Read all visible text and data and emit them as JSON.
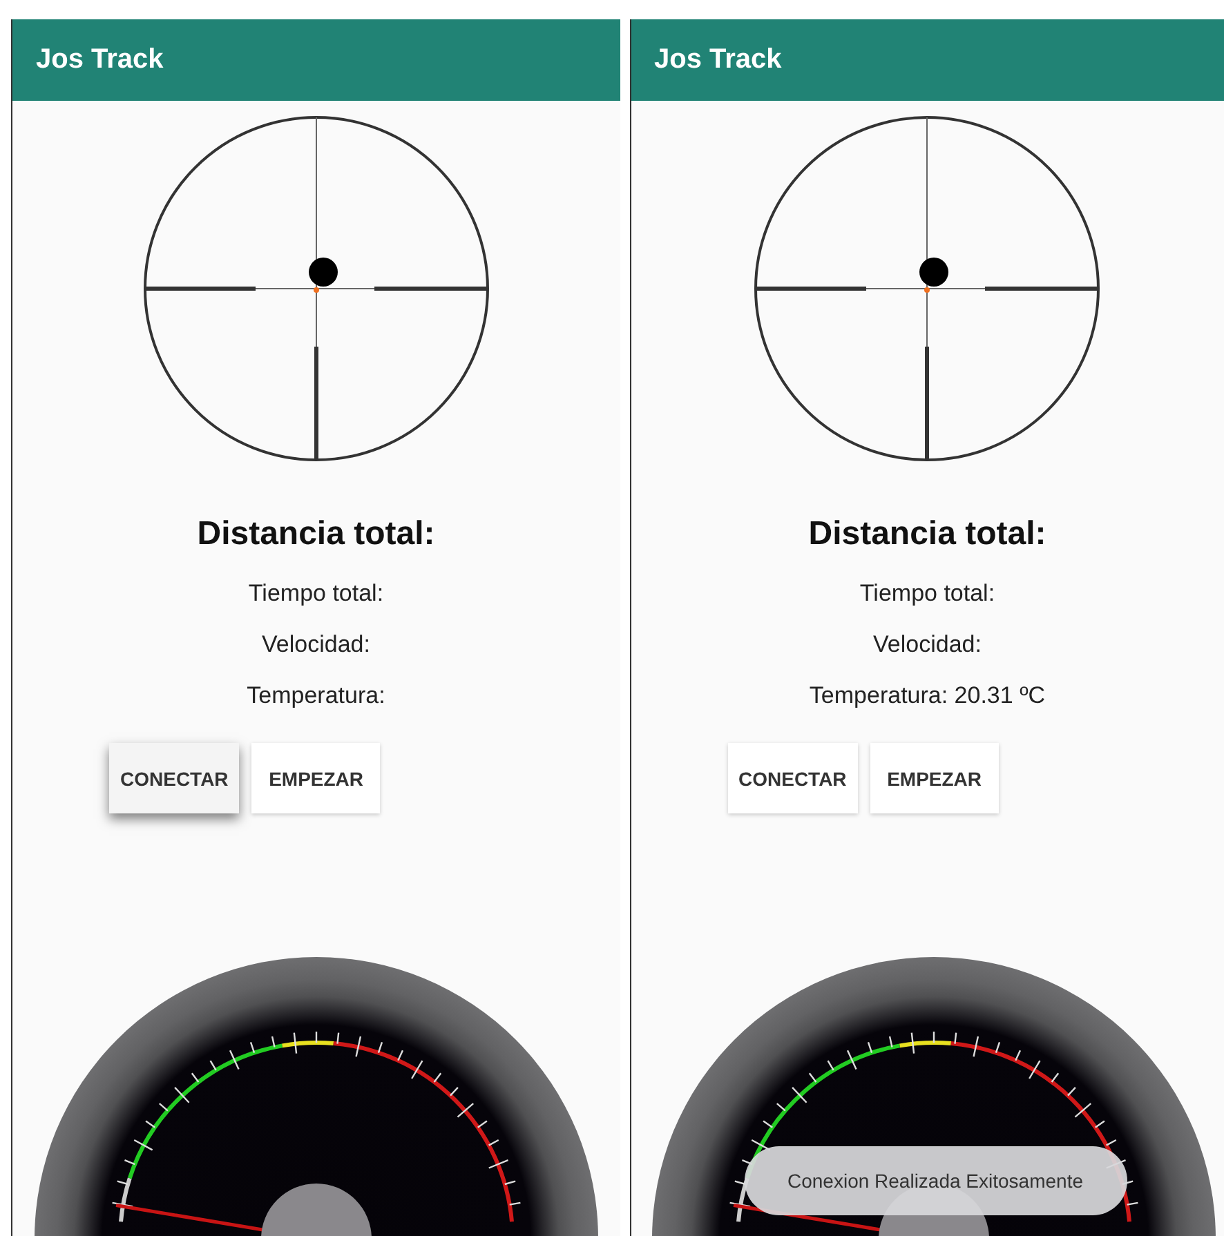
{
  "phones": [
    {
      "app_bar": {
        "title": "Jos Track"
      },
      "distance_label": "Distancia total:",
      "stats": [
        "Tiempo total:",
        "Velocidad:",
        "Temperatura:"
      ],
      "buttons": [
        {
          "label": "CONECTAR",
          "pressed": true
        },
        {
          "label": "EMPEZAR",
          "pressed": false
        }
      ]
    },
    {
      "app_bar": {
        "title": "Jos Track"
      },
      "distance_label": "Distancia total:",
      "stats": [
        "Tiempo total:",
        "Velocidad:",
        "Temperatura: 20.31 ºC"
      ],
      "buttons": [
        {
          "label": "CONECTAR",
          "pressed": false
        },
        {
          "label": "EMPEZAR",
          "pressed": false
        }
      ],
      "toast": "Conexion Realizada Exitosamente"
    }
  ]
}
